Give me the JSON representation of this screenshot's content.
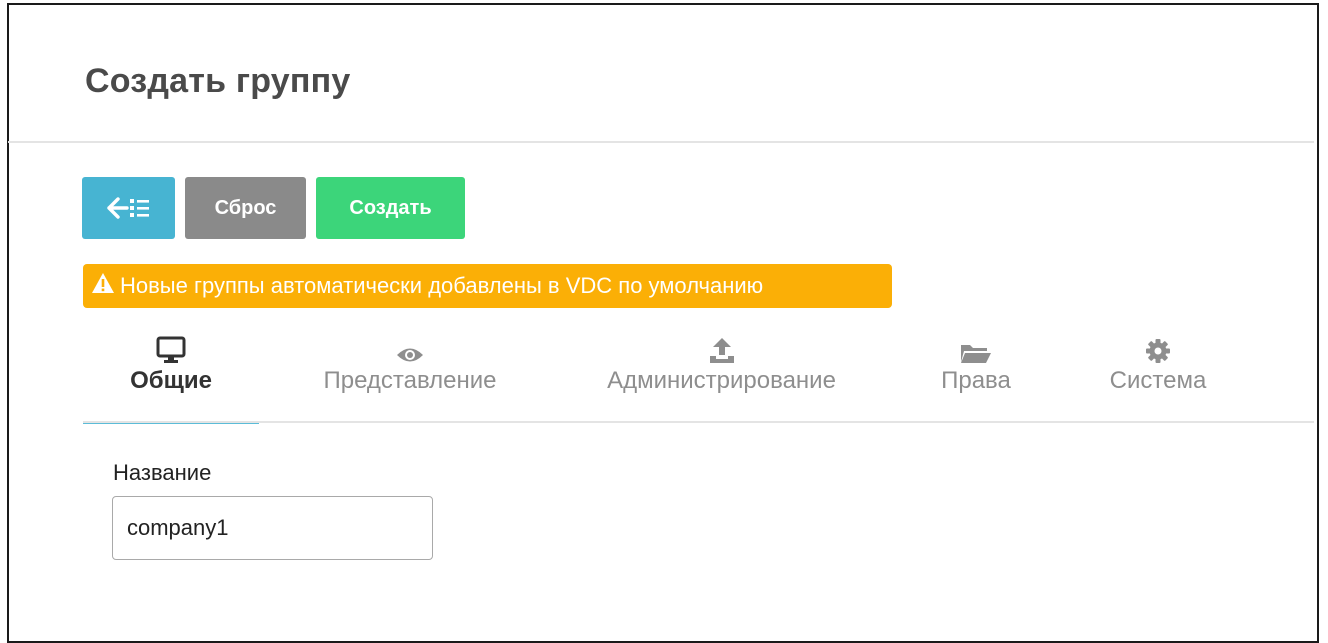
{
  "header": {
    "title": "Создать группу"
  },
  "toolbar": {
    "back_icon": "arrow-left-list-icon",
    "reset_label": "Сброс",
    "create_label": "Создать",
    "colors": {
      "back": "#47b4d2",
      "reset": "#8a8a8a",
      "create": "#3cd57a"
    }
  },
  "notice": {
    "icon": "warning-triangle-icon",
    "text": "Новые группы автоматически добавлены в VDC по умолчанию",
    "color": "#fbaf06"
  },
  "tabs": [
    {
      "label": "Общие",
      "icon": "monitor-icon",
      "active": true
    },
    {
      "label": "Представление",
      "icon": "eye-icon",
      "active": false
    },
    {
      "label": "Администрирование",
      "icon": "upload-icon",
      "active": false
    },
    {
      "label": "Права",
      "icon": "folder-open-icon",
      "active": false
    },
    {
      "label": "Система",
      "icon": "gear-icon",
      "active": false
    }
  ],
  "form": {
    "name_label": "Название",
    "name_value": "company1"
  }
}
